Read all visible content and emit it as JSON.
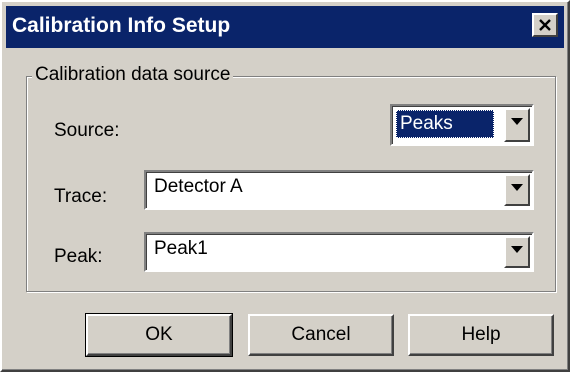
{
  "window": {
    "title": "Calibration Info Setup",
    "close_symbol": "close-icon"
  },
  "group": {
    "legend": "Calibration data source"
  },
  "fields": {
    "source": {
      "label": "Source:",
      "value": "Peaks"
    },
    "trace": {
      "label": "Trace:",
      "value": "Detector A"
    },
    "peak": {
      "label": "Peak:",
      "value": "Peak1"
    }
  },
  "buttons": {
    "ok": "OK",
    "cancel": "Cancel",
    "help": "Help"
  },
  "colors": {
    "titlebar": "#0a246a",
    "face": "#d4d0c8",
    "selection": "#0a246a"
  }
}
